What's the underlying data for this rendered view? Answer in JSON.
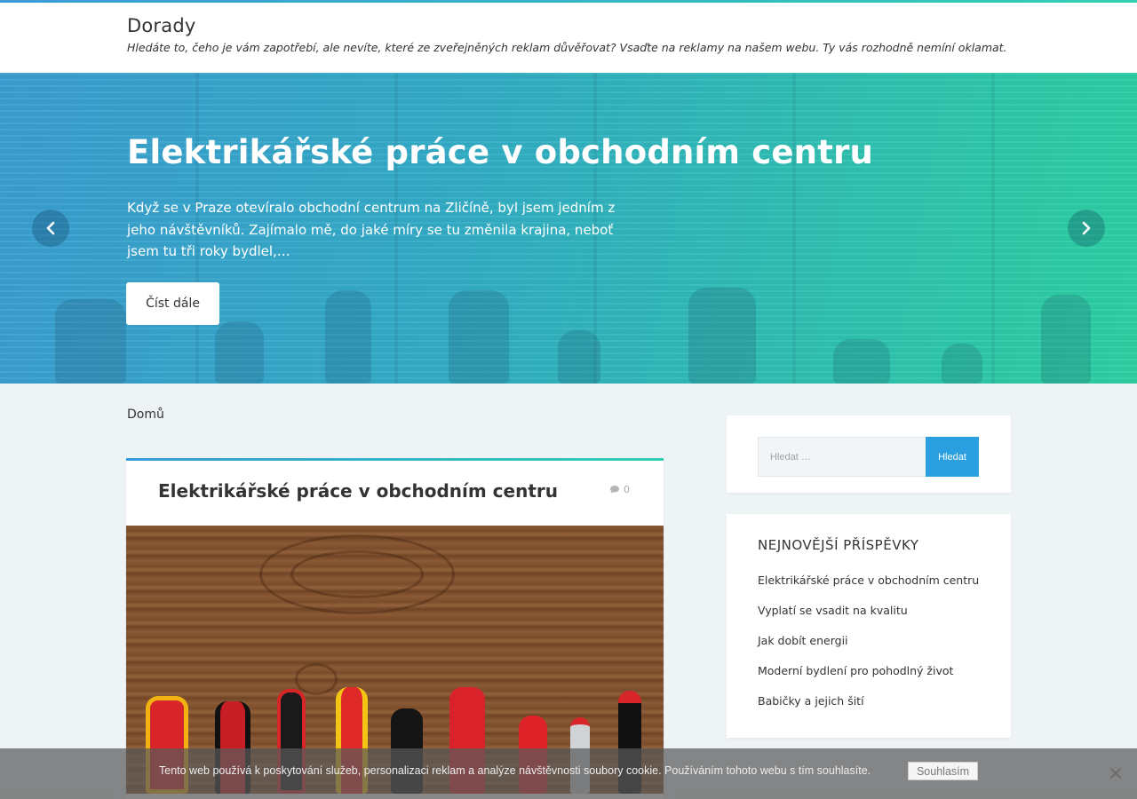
{
  "site": {
    "title": "Dorady",
    "tagline": "Hledáte to, čeho je vám zapotřebí, ale nevíte, které ze zveřejněných reklam důvěřovat? Vsaďte na reklamy na našem webu. Ty vás rozhodně nemíní oklamat."
  },
  "hero": {
    "title": "Elektrikářské práce v obchodním centru",
    "excerpt": "Když se v Praze otevíralo obchodní centrum na Zličíně, byl jsem jedním z jeho návštěvníků. Zajímalo mě, do jaké míry se tu změnila krajina, neboť jsem tu tři roky bydlel,…",
    "read_more": "Číst dále",
    "prev_icon": "chevron-left-icon",
    "next_icon": "chevron-right-icon"
  },
  "breadcrumb": {
    "home": "Domů"
  },
  "post": {
    "title": "Elektrikářské práce v obchodním centru",
    "comment_count": "0",
    "comment_icon": "comment-icon"
  },
  "sidebar": {
    "search": {
      "placeholder": "Hledat …",
      "button": "Hledat"
    },
    "recent": {
      "heading": "NEJNOVĚJŠÍ PŘÍSPĚVKY",
      "items": [
        "Elektrikářské práce v obchodním centru",
        "Vyplatí se vsadit na kvalitu",
        "Jak dobít energii",
        "Moderní bydlení pro pohodlný život",
        "Babičky a jejich šití"
      ]
    }
  },
  "cookie": {
    "text": "Tento web používá k poskytování služeb, personalizaci reklam a analýze návštěvnosti soubory cookie. Používáním tohoto webu s tím souhlasíte.",
    "accept": "Souhlasím",
    "close_icon": "close-icon"
  },
  "colors": {
    "accent": "#2aa0e0",
    "gradient_start": "#3a9ad9",
    "gradient_end": "#2fd0b0",
    "background": "#eef3f6"
  }
}
